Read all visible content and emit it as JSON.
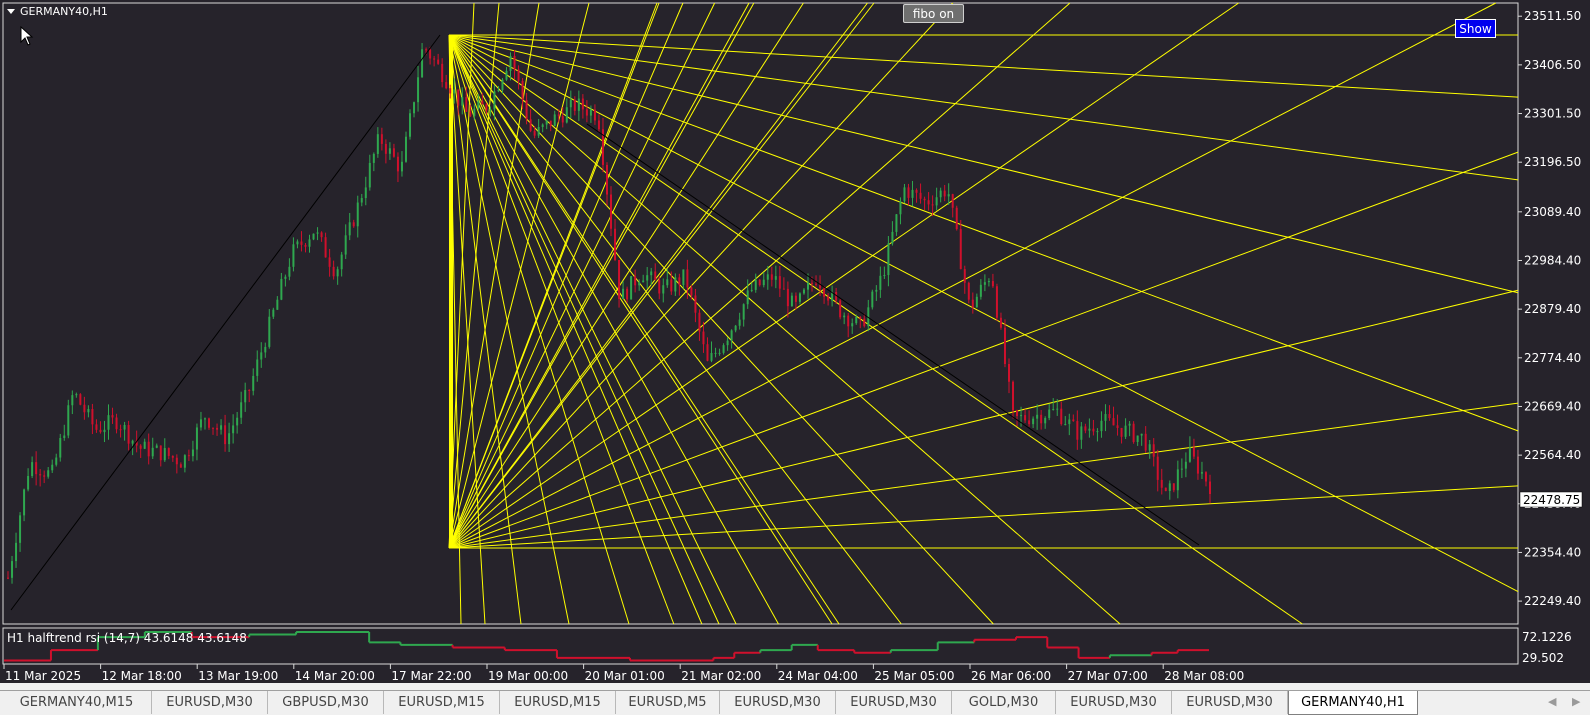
{
  "chart": {
    "symbol_label": "GERMANY40,H1",
    "fibo_button": "fibo on",
    "show_button": "Show",
    "current_price": "22478.75",
    "price_axis": [
      "23511.50",
      "23406.50",
      "23301.50",
      "23196.50",
      "23089.40",
      "22984.40",
      "22879.40",
      "22774.40",
      "22669.40",
      "22564.40",
      "22459.40",
      "22354.40",
      "22249.40"
    ],
    "time_axis": [
      "11 Mar 2025",
      "12 Mar 18:00",
      "13 Mar 19:00",
      "14 Mar 20:00",
      "17 Mar 22:00",
      "19 Mar 00:00",
      "20 Mar 01:00",
      "21 Mar 02:00",
      "24 Mar 04:00",
      "25 Mar 05:00",
      "26 Mar 06:00",
      "27 Mar 07:00",
      "28 Mar 08:00"
    ],
    "price_range": [
      22200,
      23540
    ],
    "colors": {
      "background": "#26232b",
      "bull": "#2fa84f",
      "bear": "#d0102c",
      "fibo": "#ffff00",
      "trendline": "#000000",
      "text": "#ffffff"
    },
    "close_path": [
      22300,
      22550,
      22520,
      22700,
      22620,
      22640,
      22580,
      22570,
      22550,
      22650,
      22600,
      22700,
      22850,
      23000,
      23050,
      22960,
      23100,
      23250,
      23180,
      23450,
      23380,
      23300,
      23320,
      23430,
      23250,
      23290,
      23320,
      23300,
      22900,
      22960,
      22920,
      22950,
      22760,
      22830,
      22920,
      22950,
      22880,
      22950,
      22880,
      22840,
      22950,
      23140,
      23110,
      23140,
      22880,
      22960,
      22640,
      22650,
      22660,
      22610,
      22640,
      22620,
      22600,
      22470,
      22570,
      22500
    ]
  },
  "indicator": {
    "label": "H1 halftrend rsi (14,7) 43.6148 43.6148",
    "axis_high": "72.1226",
    "axis_low": "29.502",
    "segments": [
      [
        0.0,
        0.7,
        "#d0102c"
      ],
      [
        0.7,
        1.0,
        "#d0102c"
      ],
      [
        1.0,
        1.3,
        "#2fa84f"
      ],
      [
        1.3,
        1.5,
        "#2fa84f"
      ],
      [
        1.5,
        1.8,
        "#2fa84f"
      ],
      [
        1.8,
        2.1,
        "#2fa84f"
      ],
      [
        2.1,
        2.4,
        "#d0102c"
      ],
      [
        2.4,
        2.7,
        "#d0102c"
      ],
      [
        2.7,
        3.0,
        "#2fa84f"
      ],
      [
        3.0,
        3.3,
        "#2fa84f"
      ],
      [
        3.3,
        3.6,
        "#2fa84f"
      ],
      [
        3.6,
        3.9,
        "#2fa84f"
      ],
      [
        3.9,
        4.2,
        "#2fa84f"
      ],
      [
        4.2,
        4.5,
        "#2fa84f"
      ],
      [
        4.5,
        4.8,
        "#d0102c"
      ],
      [
        4.8,
        5.1,
        "#d0102c"
      ],
      [
        5.1,
        5.4,
        "#d0102c"
      ],
      [
        5.4,
        5.7,
        "#d0102c"
      ],
      [
        5.7,
        6.0,
        "#d0102c"
      ],
      [
        6.0,
        6.3,
        "#d0102c"
      ],
      [
        6.3,
        6.6,
        "#d0102c"
      ],
      [
        6.6,
        6.9,
        "#d0102c"
      ],
      [
        6.9,
        7.2,
        "#d0102c"
      ],
      [
        7.2,
        7.5,
        "#d0102c"
      ],
      [
        7.5,
        7.8,
        "#d0102c"
      ],
      [
        7.8,
        8.1,
        "#2fa84f"
      ],
      [
        8.1,
        8.4,
        "#2fa84f"
      ],
      [
        8.4,
        8.7,
        "#d0102c"
      ],
      [
        8.7,
        9.0,
        "#d0102c"
      ],
      [
        9.0,
        9.3,
        "#2fa84f"
      ],
      [
        9.3,
        9.6,
        "#2fa84f"
      ],
      [
        9.6,
        9.9,
        "#2fa84f"
      ],
      [
        9.9,
        10.2,
        "#2fa84f"
      ],
      [
        10.2,
        10.5,
        "#d0102c"
      ],
      [
        10.5,
        10.8,
        "#d0102c"
      ],
      [
        10.8,
        11.1,
        "#d0102c"
      ],
      [
        11.1,
        11.4,
        "#d0102c"
      ],
      [
        11.4,
        11.7,
        "#2fa84f"
      ],
      [
        11.7,
        12.0,
        "#d0102c"
      ],
      [
        12.0,
        12.3,
        "#d0102c"
      ],
      [
        12.3,
        12.6,
        "#d0102c"
      ]
    ],
    "values": [
      [
        0.0,
        29.9
      ],
      [
        0.09,
        29.9
      ],
      [
        0.09,
        44.3
      ],
      [
        0.18,
        44.3
      ],
      [
        0.18,
        62.3
      ],
      [
        0.27,
        62.3
      ],
      [
        0.27,
        69.5
      ],
      [
        0.36,
        69.5
      ],
      [
        0.36,
        62.3
      ],
      [
        0.47,
        62.3
      ],
      [
        0.47,
        65.9
      ],
      [
        0.56,
        65.9
      ],
      [
        0.56,
        69.5
      ],
      [
        0.7,
        69.5
      ],
      [
        0.7,
        55.1
      ],
      [
        0.76,
        55.1
      ],
      [
        0.76,
        51.5
      ],
      [
        0.86,
        51.5
      ],
      [
        0.86,
        47.9
      ],
      [
        0.96,
        47.9
      ],
      [
        0.96,
        44.3
      ],
      [
        1.06,
        44.3
      ],
      [
        1.06,
        33.5
      ],
      [
        1.2,
        33.5
      ],
      [
        1.2,
        29.9
      ],
      [
        1.36,
        29.9
      ],
      [
        1.36,
        33.5
      ],
      [
        1.4,
        33.5
      ],
      [
        1.4,
        40.7
      ],
      [
        1.45,
        40.7
      ],
      [
        1.45,
        44.3
      ],
      [
        1.51,
        44.3
      ],
      [
        1.51,
        51.5
      ],
      [
        1.56,
        51.5
      ],
      [
        1.56,
        44.3
      ],
      [
        1.63,
        44.3
      ],
      [
        1.63,
        40.7
      ],
      [
        1.7,
        40.7
      ],
      [
        1.7,
        44.3
      ],
      [
        1.79,
        44.3
      ],
      [
        1.79,
        55.1
      ],
      [
        1.86,
        55.1
      ],
      [
        1.86,
        58.7
      ],
      [
        1.94,
        58.7
      ],
      [
        1.94,
        62.3
      ],
      [
        2.0,
        62.3
      ],
      [
        2.0,
        47.9
      ],
      [
        2.06,
        47.9
      ],
      [
        2.06,
        33.5
      ],
      [
        2.12,
        33.5
      ],
      [
        2.12,
        37.1
      ],
      [
        2.2,
        37.1
      ],
      [
        2.2,
        40.7
      ],
      [
        2.25,
        40.7
      ],
      [
        2.25,
        44.3
      ],
      [
        2.31,
        44.3
      ]
    ]
  },
  "tabs": [
    "GERMANY40,M15",
    "EURUSD,M30",
    "GBPUSD,M30",
    "EURUSD,M15",
    "EURUSD,M15",
    "EURUSD,M5",
    "EURUSD,M30",
    "EURUSD,M30",
    "GOLD,M30",
    "EURUSD,M30",
    "EURUSD,M30",
    "GERMANY40,H1"
  ],
  "active_tab": 11
}
